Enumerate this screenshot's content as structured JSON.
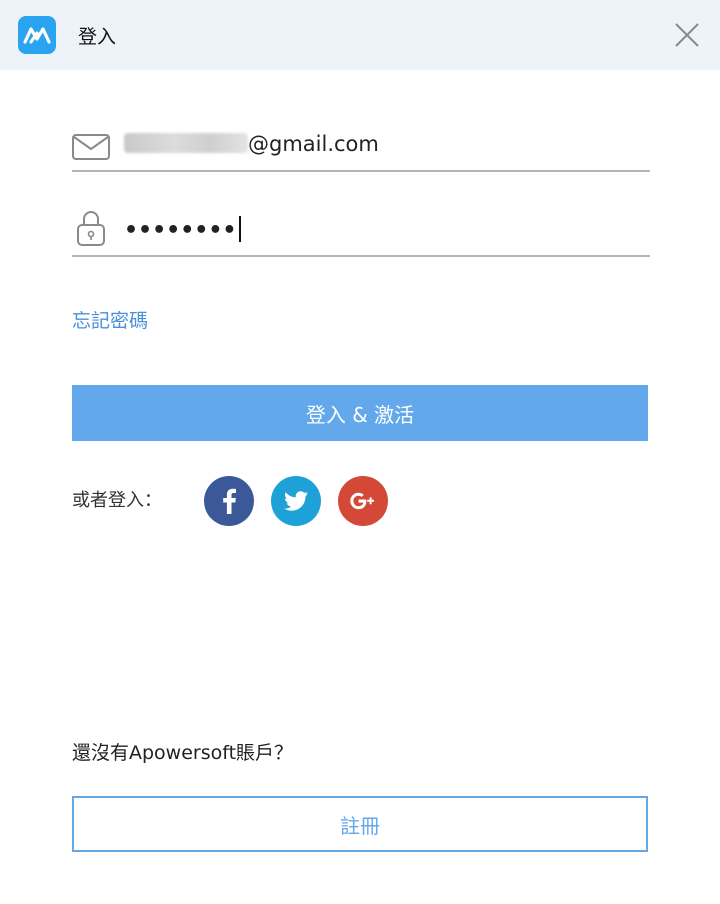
{
  "window": {
    "title": "登入",
    "logo_icon": "apowersoft-logo-icon",
    "close_icon": "close-icon"
  },
  "form": {
    "email_icon": "envelope-icon",
    "email_domain": "@gmail.com",
    "password_icon": "lock-icon",
    "password_value": "••••••••",
    "forgot_label": "忘記密碼",
    "login_label": "登入 & 激活"
  },
  "social": {
    "label": "或者登入：",
    "facebook": {
      "name": "facebook-icon",
      "color": "#3b5998"
    },
    "twitter": {
      "name": "twitter-icon",
      "color": "#1da1d6"
    },
    "google": {
      "name": "google-plus-icon",
      "color": "#d34836"
    }
  },
  "footer": {
    "no_account_text": "還沒有Apowersoft賬戶？",
    "register_label": "註冊"
  },
  "colors": {
    "accent": "#63a8eb",
    "link": "#4a90d9",
    "titlebar": "#eef3fa"
  }
}
